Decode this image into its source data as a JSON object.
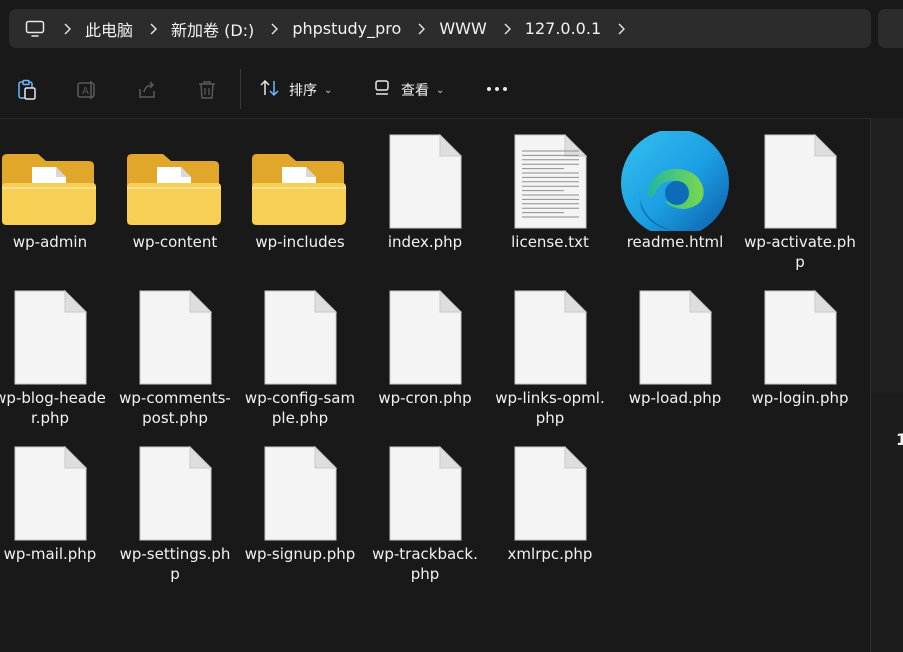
{
  "address_bar": {
    "crumbs": [
      "此电脑",
      "新加卷 (D:)",
      "phpstudy_pro",
      "WWW",
      "127.0.0.1"
    ]
  },
  "toolbar": {
    "sort_label": "排序",
    "view_label": "查看"
  },
  "right_pane": {
    "partial_text": "1"
  },
  "files": [
    {
      "name": "wp-admin",
      "type": "folder"
    },
    {
      "name": "wp-content",
      "type": "folder"
    },
    {
      "name": "wp-includes",
      "type": "folder"
    },
    {
      "name": "index.php",
      "type": "file"
    },
    {
      "name": "license.txt",
      "type": "text"
    },
    {
      "name": "readme.html",
      "type": "edge"
    },
    {
      "name": "wp-activate.php",
      "type": "file"
    },
    {
      "name": "wp-blog-header.php",
      "type": "file"
    },
    {
      "name": "wp-comments-post.php",
      "type": "file"
    },
    {
      "name": "wp-config-sample.php",
      "type": "file"
    },
    {
      "name": "wp-cron.php",
      "type": "file"
    },
    {
      "name": "wp-links-opml.php",
      "type": "file"
    },
    {
      "name": "wp-load.php",
      "type": "file"
    },
    {
      "name": "wp-login.php",
      "type": "file"
    },
    {
      "name": "wp-mail.php",
      "type": "file"
    },
    {
      "name": "wp-settings.php",
      "type": "file"
    },
    {
      "name": "wp-signup.php",
      "type": "file"
    },
    {
      "name": "wp-trackback.php",
      "type": "file"
    },
    {
      "name": "xmlrpc.php",
      "type": "file"
    }
  ]
}
